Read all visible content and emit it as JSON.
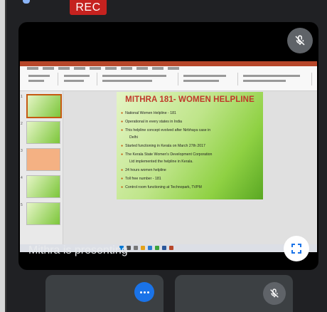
{
  "meeting": {
    "rec_label": "REC",
    "presenter_label": "Mithra is presenting"
  },
  "slide": {
    "title": "MITHRA 181- WOMEN HELPLINE",
    "bullets": [
      "National Women Helpline - 181",
      "Operational in every states in India",
      "This helpline concept evolved after Nirbhaya case in",
      "Started functioning in Kerala  on March 27th 2017",
      "The Kerala State Women's Development Corporation",
      "24 hours women helpline",
      "Toll free number - 181",
      "Control room functioning at Technopark, TVPM"
    ],
    "continuations": [
      "Delhi",
      "Ltd  implemented the helpline in Kerala."
    ],
    "thumb_numbers": [
      "1",
      "2",
      "3",
      "4",
      "5"
    ]
  },
  "colors": {
    "rec": "#c5221f",
    "title": "#c0392b",
    "accent_blue": "#1a73e8"
  },
  "icons": [
    "mic-off-icon",
    "fullscreen-icon",
    "more-dots-icon"
  ]
}
